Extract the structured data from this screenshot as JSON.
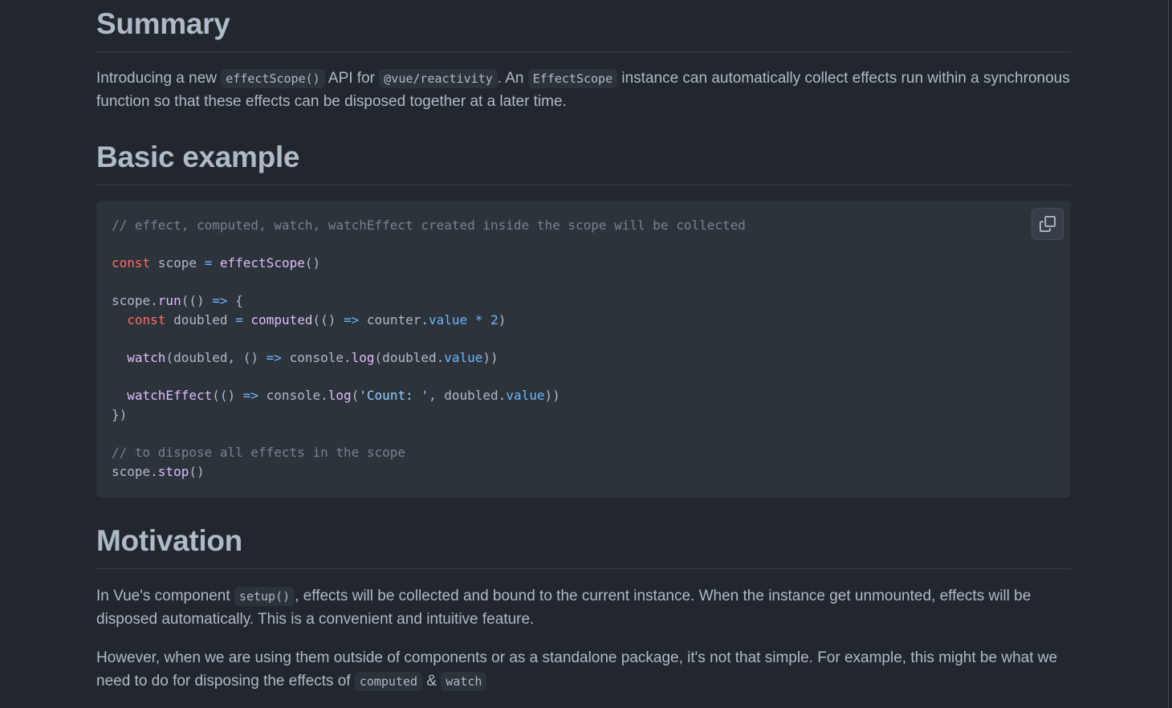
{
  "summary": {
    "heading": "Summary",
    "p1_a": "Introducing a new ",
    "p1_code1": "effectScope()",
    "p1_b": " API for ",
    "p1_code2": "@vue/reactivity",
    "p1_c": ". An ",
    "p1_code3": "EffectScope",
    "p1_d": " instance can automatically collect effects run within a synchronous function so that these effects can be disposed together at a later time."
  },
  "basic_example": {
    "heading": "Basic example",
    "copy_icon": "copy-icon",
    "code": {
      "l1": "// effect, computed, watch, watchEffect created inside the scope will be collected",
      "l3_kw": "const",
      "l3_a": " scope ",
      "l3_op": "=",
      "l3_sp": " ",
      "l3_fn": "effectScope",
      "l3_b": "()",
      "l5_a": "scope.",
      "l5_fn": "run",
      "l5_b": "(() ",
      "l5_op": "=>",
      "l5_c": " {",
      "l6_indent": "  ",
      "l6_kw": "const",
      "l6_a": " doubled ",
      "l6_op": "=",
      "l6_sp": " ",
      "l6_fn": "computed",
      "l6_b": "(() ",
      "l6_op2": "=>",
      "l6_c": " counter.",
      "l6_prop": "value",
      "l6_sp2": " ",
      "l6_op3": "*",
      "l6_sp3": " ",
      "l6_num": "2",
      "l6_d": ")",
      "l8_indent": "  ",
      "l8_fn": "watch",
      "l8_a": "(doubled, () ",
      "l8_op": "=>",
      "l8_b": " console.",
      "l8_fn2": "log",
      "l8_c": "(doubled.",
      "l8_prop": "value",
      "l8_d": "))",
      "l10_indent": "  ",
      "l10_fn": "watchEffect",
      "l10_a": "(() ",
      "l10_op": "=>",
      "l10_b": " console.",
      "l10_fn2": "log",
      "l10_c": "(",
      "l10_str": "'Count: '",
      "l10_d": ", doubled.",
      "l10_prop": "value",
      "l10_e": "))",
      "l11": "})",
      "l13": "// to dispose all effects in the scope",
      "l14_a": "scope.",
      "l14_fn": "stop",
      "l14_b": "()"
    }
  },
  "motivation": {
    "heading": "Motivation",
    "p1_a": "In Vue's component ",
    "p1_code": "setup()",
    "p1_b": ", effects will be collected and bound to the current instance. When the instance get unmounted, effects will be disposed automatically. This is a convenient and intuitive feature.",
    "p2_a": "However, when we are using them outside of components or as a standalone package, it's not that simple. For example, this might be what we need to do for disposing the effects of ",
    "p2_code1": "computed",
    "p2_b": " & ",
    "p2_code2": "watch"
  },
  "colors": {
    "background": "#22272e",
    "code_background": "#2d333b",
    "text": "#adbac7",
    "keyword": "#f47067",
    "function": "#dcbdfb",
    "operator": "#6cb6ff",
    "string": "#96d0ff",
    "comment": "#768390"
  }
}
